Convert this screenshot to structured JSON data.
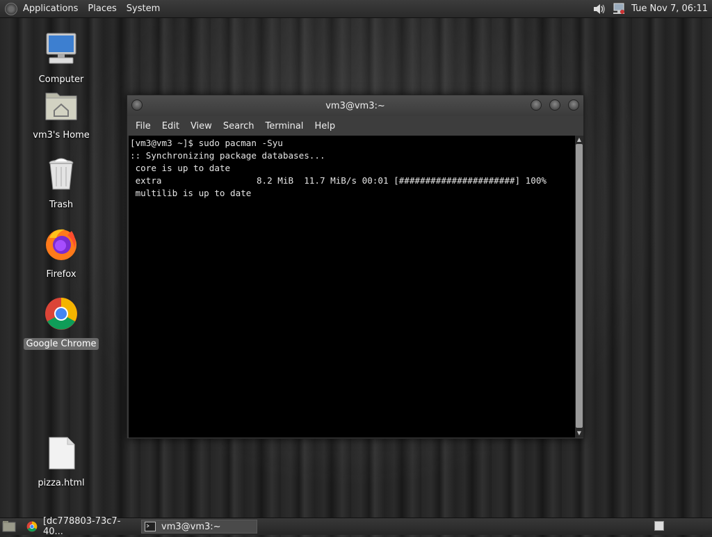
{
  "top_panel": {
    "menus": [
      "Applications",
      "Places",
      "System"
    ],
    "clock": "Tue Nov  7, 06:11"
  },
  "desktop": {
    "icons": [
      {
        "label": "Computer",
        "icon": "computer-icon"
      },
      {
        "label": "vm3's Home",
        "icon": "home-folder-icon"
      },
      {
        "label": "Trash",
        "icon": "trash-icon"
      },
      {
        "label": "Firefox",
        "icon": "firefox-icon"
      },
      {
        "label": "Google Chrome",
        "icon": "chrome-icon"
      },
      {
        "label": "pizza.html",
        "icon": "file-icon"
      }
    ]
  },
  "terminal": {
    "title": "vm3@vm3:~",
    "menu": [
      "File",
      "Edit",
      "View",
      "Search",
      "Terminal",
      "Help"
    ],
    "lines": [
      "[vm3@vm3 ~]$ sudo pacman -Syu",
      ":: Synchronizing package databases...",
      " core is up to date",
      " extra                  8.2 MiB  11.7 MiB/s 00:01 [######################] 100%",
      " multilib is up to date"
    ]
  },
  "taskbar": {
    "tasks": [
      {
        "label": "[dc778803-73c7-40..."
      },
      {
        "label": "vm3@vm3:~"
      }
    ]
  }
}
